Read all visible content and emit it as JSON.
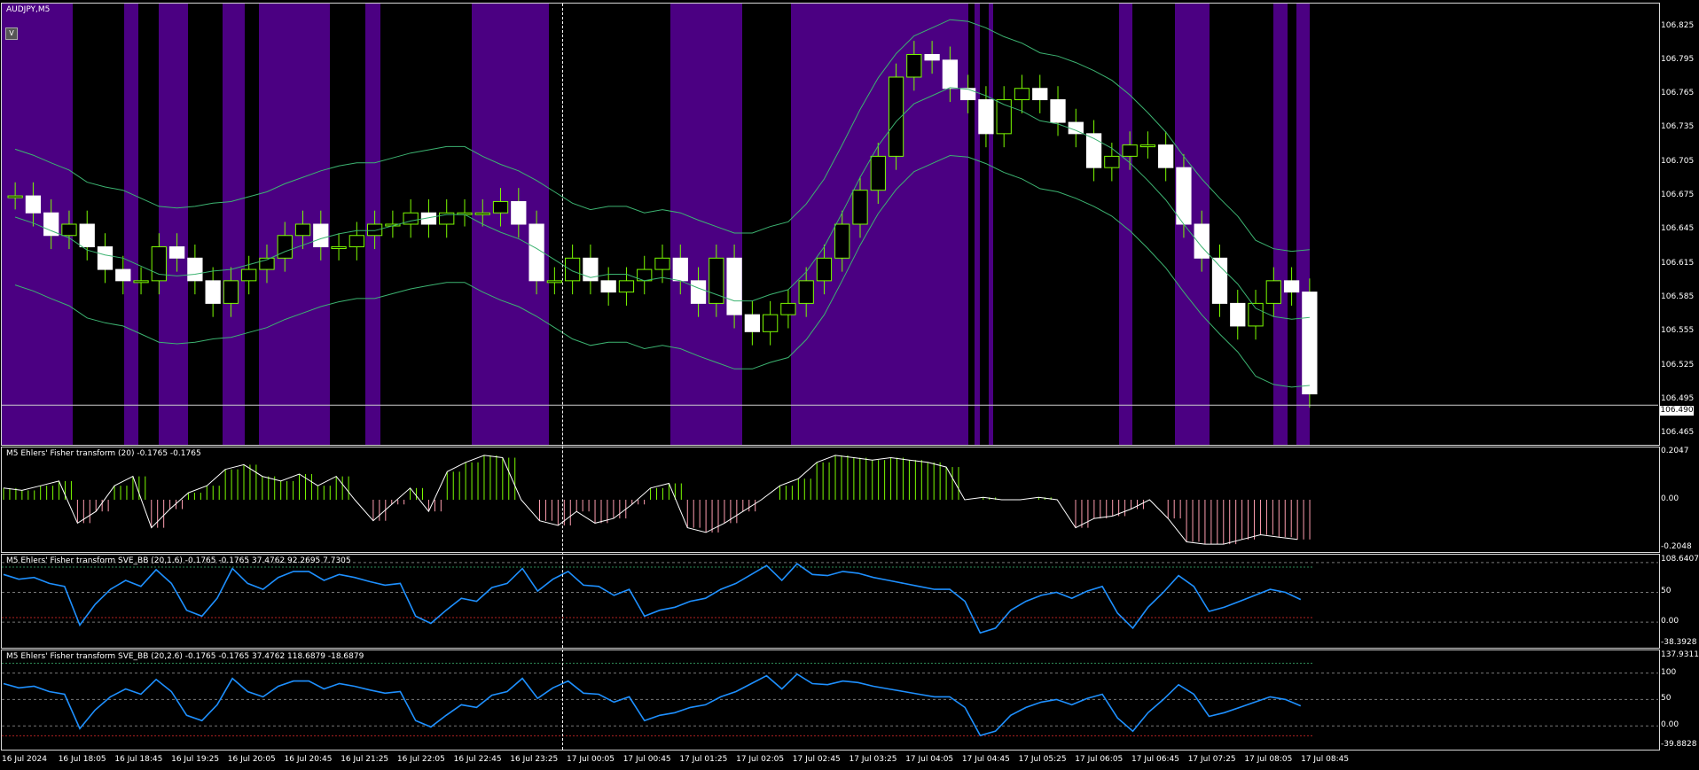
{
  "chart": {
    "symbol_label": "AUDJPY,M5",
    "v_button": "V",
    "current_price": "106.490",
    "price_ticks": [
      "106.825",
      "106.795",
      "106.765",
      "106.735",
      "106.705",
      "106.675",
      "106.645",
      "106.615",
      "106.585",
      "106.555",
      "106.525",
      "106.495",
      "106.465"
    ],
    "time_labels": [
      "16 Jul 2024",
      "16 Jul 18:05",
      "16 Jul 18:45",
      "16 Jul 19:25",
      "16 Jul 20:05",
      "16 Jul 20:45",
      "16 Jul 21:25",
      "16 Jul 22:05",
      "16 Jul 22:45",
      "16 Jul 23:25",
      "17 Jul 00:05",
      "17 Jul 00:45",
      "17 Jul 01:25",
      "17 Jul 02:05",
      "17 Jul 02:45",
      "17 Jul 03:25",
      "17 Jul 04:05",
      "17 Jul 04:45",
      "17 Jul 05:25",
      "17 Jul 06:05",
      "17 Jul 06:45",
      "17 Jul 07:25",
      "17 Jul 08:05",
      "17 Jul 08:45"
    ],
    "colors": {
      "background": "#000000",
      "session_band": "#4b0082",
      "candle": "#7cfc00",
      "bollinger": "#3cb371",
      "fisher_up": "#7cfc00",
      "fisher_down": "#ff9eb0",
      "sve_line": "#1e90ff",
      "upper_band": "#2e8b57",
      "lower_band": "#b22222"
    }
  },
  "indicators": {
    "fisher": {
      "label": "M5 Ehlers' Fisher transform (20) -0.1765 -0.1765",
      "ticks": [
        "0.2047",
        "0.00",
        "-0.2048"
      ]
    },
    "sve1": {
      "label": "M5 Ehlers' Fisher transform SVE_BB (20,1.6) -0.1765 -0.1765 37.4762 92.2695 7.7305",
      "ticks": [
        "108.6407",
        "50",
        "0.00",
        "-38.3928"
      ]
    },
    "sve2": {
      "label": "M5 Ehlers' Fisher transform SVE_BB (20,2.6) -0.1765 -0.1765 37.4762 118.6879 -18.6879",
      "ticks": [
        "137.9311",
        "100",
        "50",
        "0.00",
        "-39.8828"
      ]
    }
  },
  "chart_data": {
    "type": "candlestick",
    "symbol": "AUDJPY",
    "timeframe": "M5",
    "ylim": [
      106.455,
      106.845
    ],
    "last_price": 106.49,
    "x_tick_labels": [
      "16 Jul 2024",
      "16 Jul 18:05",
      "16 Jul 18:45",
      "16 Jul 19:25",
      "16 Jul 20:05",
      "16 Jul 20:45",
      "16 Jul 21:25",
      "16 Jul 22:05",
      "16 Jul 22:45",
      "16 Jul 23:25",
      "17 Jul 00:05",
      "17 Jul 00:45",
      "17 Jul 01:25",
      "17 Jul 02:05",
      "17 Jul 02:45",
      "17 Jul 03:25",
      "17 Jul 04:05",
      "17 Jul 04:45",
      "17 Jul 05:25",
      "17 Jul 06:05",
      "17 Jul 06:45",
      "17 Jul 07:25",
      "17 Jul 08:05",
      "17 Jul 08:45"
    ],
    "close_approx": [
      106.675,
      106.66,
      106.64,
      106.65,
      106.63,
      106.61,
      106.6,
      106.6,
      106.63,
      106.62,
      106.6,
      106.58,
      106.6,
      106.61,
      106.62,
      106.64,
      106.65,
      106.63,
      106.63,
      106.64,
      106.65,
      106.65,
      106.66,
      106.65,
      106.66,
      106.66,
      106.66,
      106.67,
      106.65,
      106.6,
      106.6,
      106.62,
      106.6,
      106.59,
      106.6,
      106.61,
      106.62,
      106.6,
      106.58,
      106.62,
      106.57,
      106.555,
      106.57,
      106.58,
      106.6,
      106.62,
      106.65,
      106.68,
      106.71,
      106.78,
      106.8,
      106.795,
      106.77,
      106.76,
      106.73,
      106.76,
      106.77,
      106.76,
      106.74,
      106.73,
      106.7,
      106.71,
      106.72,
      106.72,
      106.7,
      106.65,
      106.62,
      106.58,
      106.56,
      106.58,
      106.6,
      106.59,
      106.5
    ],
    "fisher": {
      "ylim": [
        -0.2048,
        0.2047
      ],
      "values": [
        0.05,
        0.04,
        0.06,
        0.08,
        -0.1,
        -0.05,
        0.06,
        0.1,
        -0.12,
        -0.04,
        0.03,
        0.06,
        0.13,
        0.15,
        0.1,
        0.08,
        0.11,
        0.06,
        0.1,
        0.0,
        -0.09,
        -0.02,
        0.05,
        -0.05,
        0.12,
        0.16,
        0.19,
        0.18,
        0.0,
        -0.09,
        -0.11,
        -0.05,
        -0.1,
        -0.08,
        -0.02,
        0.05,
        0.07,
        -0.12,
        -0.14,
        -0.1,
        -0.05,
        0.0,
        0.06,
        0.09,
        0.16,
        0.19,
        0.18,
        0.17,
        0.18,
        0.17,
        0.16,
        0.14,
        0.0,
        0.01,
        0.0,
        0.0,
        0.01,
        0.0,
        -0.12,
        -0.08,
        -0.07,
        -0.04,
        0.0,
        -0.08,
        -0.18,
        -0.19,
        -0.19,
        -0.17,
        -0.15,
        -0.16,
        -0.17
      ]
    },
    "sve1": {
      "ylim": [
        -38.3928,
        108.6407
      ],
      "upper_value": 92.2695,
      "lower_value": 7.7305,
      "values": [
        80,
        72,
        75,
        65,
        60,
        -5,
        30,
        55,
        70,
        60,
        88,
        65,
        20,
        10,
        40,
        90,
        65,
        55,
        75,
        85,
        85,
        70,
        80,
        75,
        68,
        62,
        65,
        10,
        -2,
        20,
        40,
        35,
        58,
        65,
        90,
        52,
        72,
        85,
        62,
        60,
        45,
        55,
        10,
        20,
        25,
        35,
        40,
        55,
        65,
        80,
        95,
        70,
        98,
        80,
        78,
        85,
        82,
        75,
        70,
        65,
        60,
        55,
        55,
        35,
        -18,
        -10,
        20,
        35,
        45,
        50,
        40,
        52,
        60,
        15,
        -10,
        25,
        50,
        78,
        60,
        18,
        25,
        35,
        45,
        55,
        50,
        38
      ]
    },
    "sve2": {
      "ylim": [
        -39.8828,
        137.9311
      ],
      "upper_value": 118.6879,
      "lower_value": -18.6879,
      "values": [
        80,
        72,
        75,
        65,
        60,
        -5,
        30,
        55,
        70,
        60,
        88,
        65,
        20,
        10,
        40,
        90,
        65,
        55,
        75,
        85,
        85,
        70,
        80,
        75,
        68,
        62,
        65,
        10,
        -2,
        20,
        40,
        35,
        58,
        65,
        90,
        52,
        72,
        85,
        62,
        60,
        45,
        55,
        10,
        20,
        25,
        35,
        40,
        55,
        65,
        80,
        95,
        70,
        98,
        80,
        78,
        85,
        82,
        75,
        70,
        65,
        60,
        55,
        55,
        35,
        -18,
        -10,
        20,
        35,
        45,
        50,
        40,
        52,
        60,
        15,
        -10,
        25,
        50,
        78,
        60,
        18,
        25,
        35,
        45,
        55,
        50,
        38
      ]
    }
  }
}
